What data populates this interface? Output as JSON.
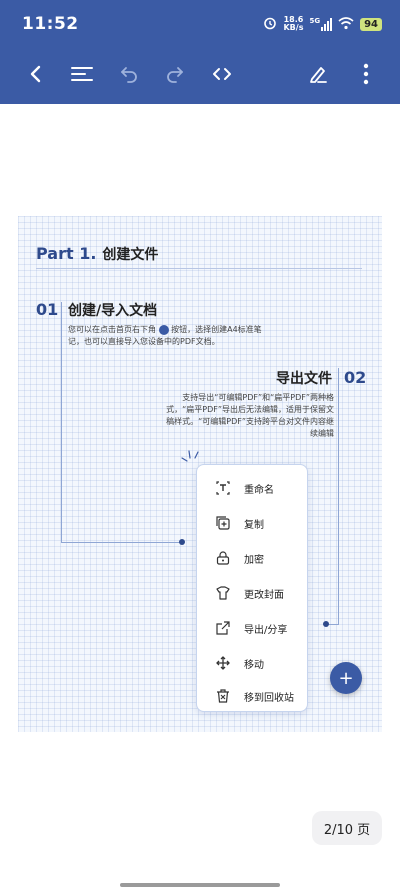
{
  "status_bar": {
    "time": "11:52",
    "net_speed_value": "18.6",
    "net_speed_unit": "KB/s",
    "signal_label": "5G",
    "battery": "94"
  },
  "toolbar": {
    "icons": [
      "back-icon",
      "menu-icon",
      "undo-icon",
      "redo-icon",
      "code-icon",
      "pen-icon",
      "more-icon"
    ]
  },
  "document": {
    "part_title": "Part 1.",
    "part_title_zh": "创建文件",
    "section1": {
      "number": "01",
      "heading": "创建/导入文档",
      "text_before": "您可以在点击首页右下角",
      "text_after": "按钮，选择创建A4标准笔记，也可以直接导入您设备中的PDF文档。"
    },
    "section2": {
      "number": "02",
      "heading": "导出文件",
      "text": "支持导出“可编辑PDF”和“扁平PDF”两种格式，“扁平PDF”导出后无法编辑，适用于保留文稿样式。“可编辑PDF”支持跨平台对文件内容继续编辑"
    },
    "menu_items": [
      {
        "label": "重命名",
        "icon": "rename-icon"
      },
      {
        "label": "复制",
        "icon": "copy-icon"
      },
      {
        "label": "加密",
        "icon": "lock-icon"
      },
      {
        "label": "更改封面",
        "icon": "cover-icon"
      },
      {
        "label": "导出/分享",
        "icon": "export-icon"
      },
      {
        "label": "移动",
        "icon": "move-icon"
      },
      {
        "label": "移到回收站",
        "icon": "trash-icon"
      }
    ],
    "fab_label": "+"
  },
  "pager": {
    "text": "2/10 页"
  },
  "colors": {
    "primary": "#3b5ba5",
    "accent_dark": "#2e4a8c",
    "grid_bg": "#f3f7fd"
  }
}
